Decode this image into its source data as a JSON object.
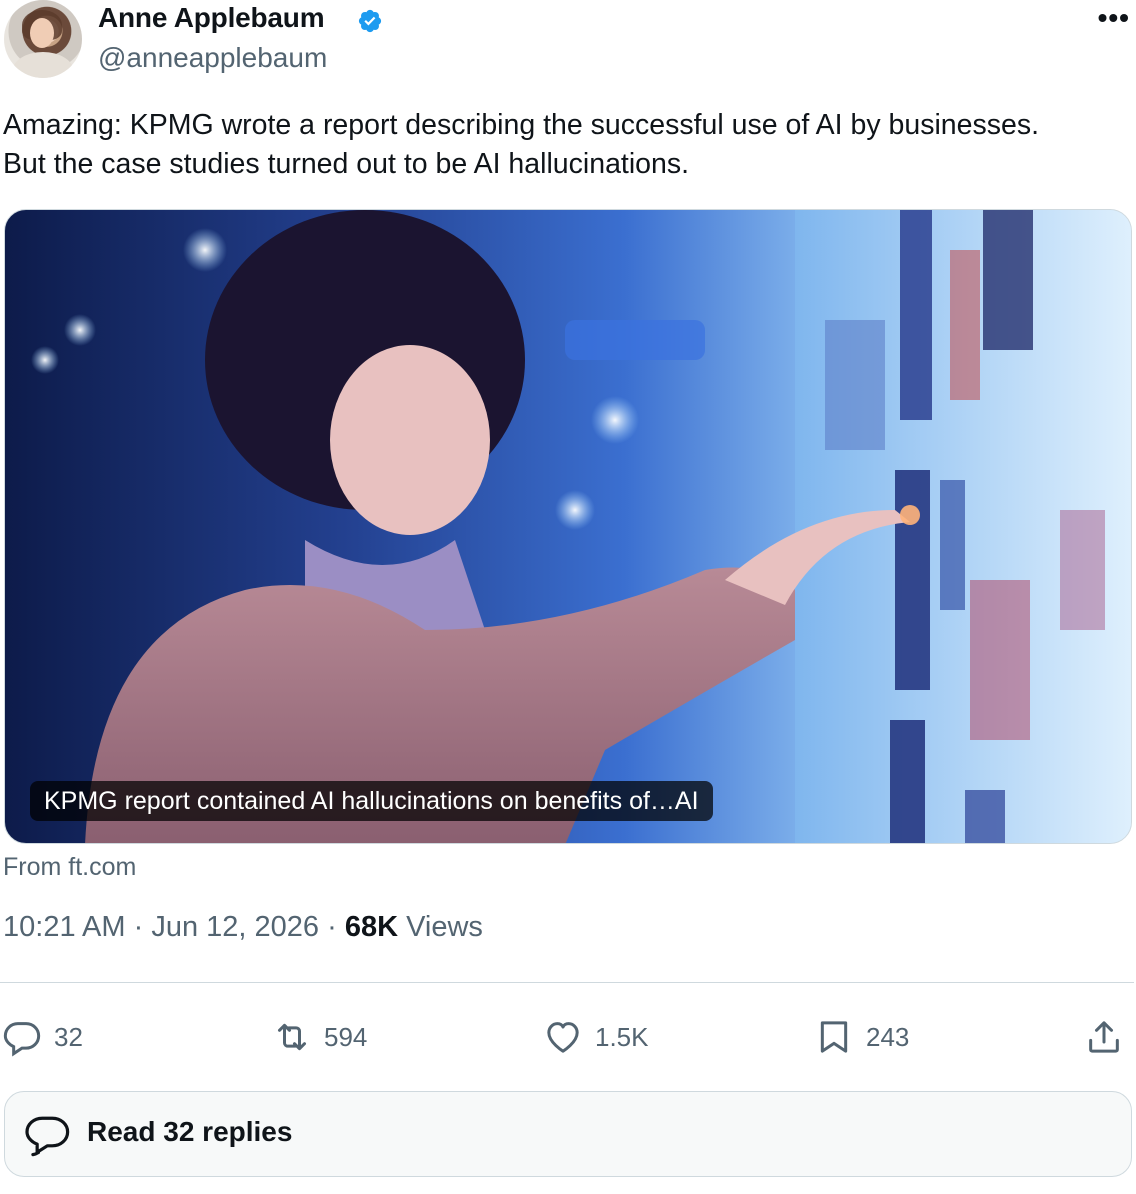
{
  "author": {
    "name": "Anne Applebaum",
    "handle": "@anneapplebaum",
    "verified": true
  },
  "tweet": {
    "text_line1": "Amazing: KPMG wrote a report describing the successful use of AI by businesses.",
    "text_line2": "But the case studies turned out to be AI hallucinations."
  },
  "card": {
    "caption": "KPMG report contained AI hallucinations on benefits of…AI",
    "source": "From ft.com"
  },
  "meta": {
    "time": "10:21 AM",
    "separator": "·",
    "date": "Jun 12, 2026",
    "views_count": "68K",
    "views_label": "Views"
  },
  "actions": {
    "replies": "32",
    "reposts": "594",
    "likes": "1.5K",
    "bookmarks": "243"
  },
  "read_replies": "Read 32 replies",
  "icons": {
    "more": "more-icon",
    "verified": "verified-badge-icon",
    "reply": "reply-icon",
    "repost": "repost-icon",
    "like": "heart-icon",
    "bookmark": "bookmark-icon",
    "share": "share-icon",
    "conversation": "conversation-icon"
  },
  "colors": {
    "verified": "#1d9bf0",
    "secondary_text": "#536471",
    "primary_text": "#0f1419"
  }
}
